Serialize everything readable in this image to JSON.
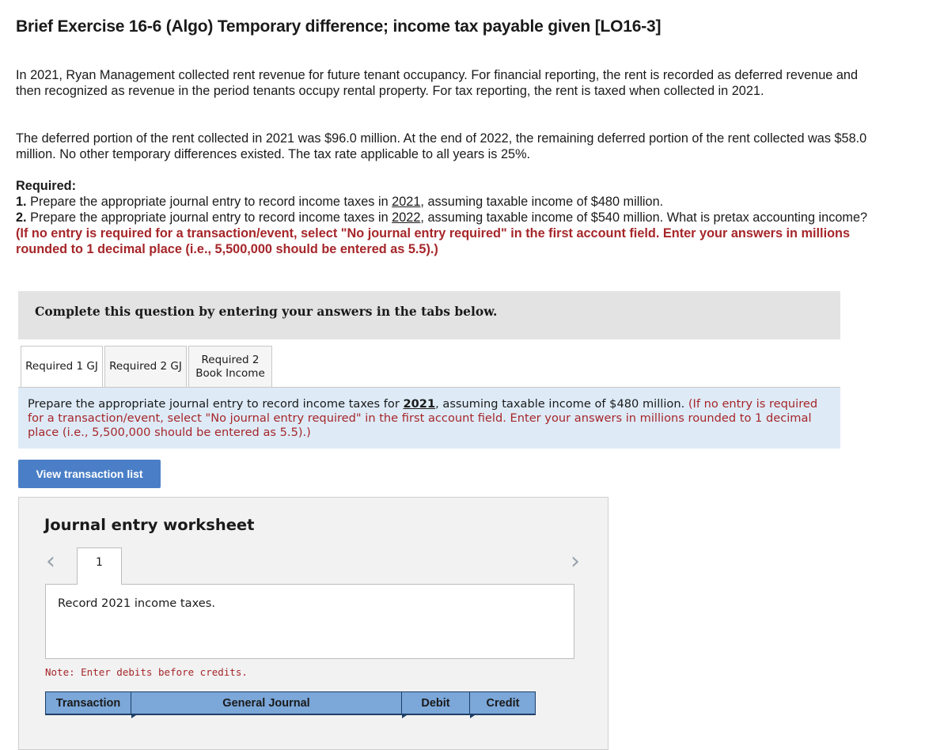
{
  "title": "Brief Exercise 16-6 (Algo) Temporary difference; income tax payable given [LO16-3]",
  "paragraph1": "In 2021, Ryan Management collected rent revenue for future tenant occupancy. For financial reporting, the rent is recorded as deferred revenue and then recognized as revenue in the period tenants occupy rental property. For tax reporting, the rent is taxed when collected in 2021.",
  "paragraph2": "The deferred portion of the rent collected in 2021 was $96.0 million. At the end of 2022, the remaining deferred portion of the rent collected was $58.0 million. No other temporary differences existed. The tax rate applicable to all years is 25%.",
  "required": {
    "heading": "Required:",
    "item1": {
      "num": "1.",
      "pre": " Prepare the appropriate journal entry to record income taxes in ",
      "year": "2021",
      "post": ", assuming taxable income of $480 million."
    },
    "item2": {
      "num": "2.",
      "pre": " Prepare the appropriate journal entry to record income taxes in ",
      "year": "2022",
      "post": ", assuming taxable income of $540 million.  What is pretax accounting income?"
    },
    "instruction": "(If no entry is required for a transaction/event, select \"No journal entry required\" in the first account field. Enter your answers in millions rounded to 1 decimal place (i.e., 5,500,000 should be entered as 5.5).)"
  },
  "banner": "Complete this question by entering your answers in the tabs below.",
  "tabs": [
    {
      "label": "Required 1 GJ"
    },
    {
      "label": "Required 2 GJ"
    },
    {
      "label_line1": "Required 2",
      "label_line2": "Book Income"
    }
  ],
  "tab_instruction": {
    "pre": "Prepare the appropriate journal entry to record income taxes for ",
    "year": "2021",
    "post": ", assuming taxable income of $480 million. ",
    "note": "(If no entry is required for a transaction/event, select \"No journal entry required\" in the first account field. Enter your answers in millions rounded to 1 decimal place (i.e., 5,500,000 should be entered as 5.5).)"
  },
  "view_button": "View transaction list",
  "worksheet": {
    "title": "Journal entry worksheet",
    "prev_icon": "chevron-left-icon",
    "next_icon": "chevron-right-icon",
    "page": "1",
    "record_text": "Record 2021 income taxes.",
    "note": "Note: Enter debits before credits.",
    "columns": [
      "Transaction",
      "General Journal",
      "Debit",
      "Credit"
    ]
  }
}
